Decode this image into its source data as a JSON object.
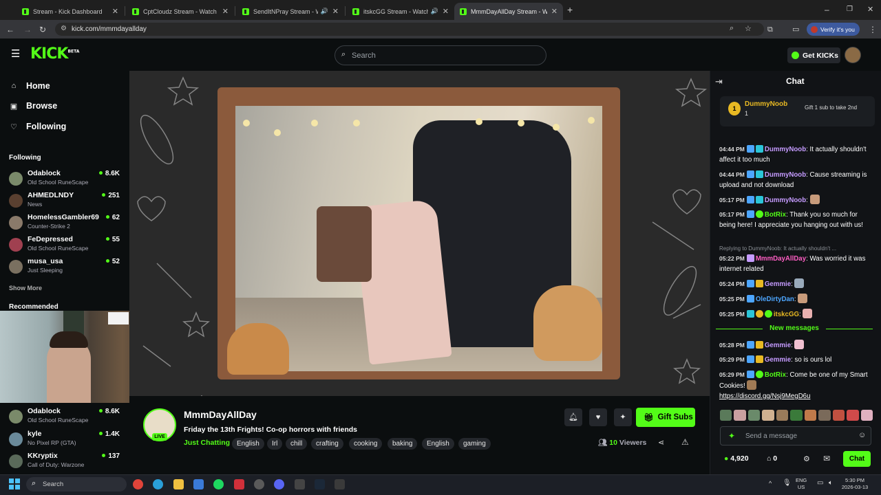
{
  "browser": {
    "tabs": [
      {
        "title": "Stream - Kick Dashboard",
        "active": false,
        "audio": false
      },
      {
        "title": "CptCloudz Stream - Watch Live",
        "active": false,
        "audio": false
      },
      {
        "title": "SendItNPray Stream - Watc",
        "active": false,
        "audio": true
      },
      {
        "title": "itskcGG Stream - Watch Liv",
        "active": false,
        "audio": true
      },
      {
        "title": "MmmDayAllDay Stream - Watc",
        "active": true,
        "audio": false
      }
    ],
    "url": "kick.com/mmmdayallday",
    "verify_label": "Verify it's you"
  },
  "header": {
    "logo": "KICK",
    "logo_sup": "BETA",
    "search_placeholder": "Search",
    "get_kicks_label": "Get KICKs"
  },
  "sidebar": {
    "nav": [
      {
        "label": "Home",
        "icon": "home-icon"
      },
      {
        "label": "Browse",
        "icon": "browse-icon"
      },
      {
        "label": "Following",
        "icon": "heart-icon"
      }
    ],
    "following_heading": "Following",
    "following": [
      {
        "name": "Odablock",
        "game": "Old School RuneScape",
        "viewers": "8.6K",
        "color": "#7a8a6a"
      },
      {
        "name": "AHMEDLNDY",
        "game": "News",
        "viewers": "251",
        "color": "#5a4030"
      },
      {
        "name": "HomelessGambler69",
        "game": "Counter-Strike 2",
        "viewers": "62",
        "color": "#8a7a6a"
      },
      {
        "name": "FeDepressed",
        "game": "Old School RuneScape",
        "viewers": "55",
        "color": "#a04050"
      },
      {
        "name": "musa_usa",
        "game": "Just Sleeping",
        "viewers": "52",
        "color": "#7a7060"
      }
    ],
    "show_more": "Show More",
    "recommended_heading": "Recommended",
    "recommended": [
      {
        "name": "Odablock",
        "game": "Old School RuneScape",
        "viewers": "8.6K",
        "color": "#7a8a6a"
      },
      {
        "name": "kyle",
        "game": "No Pixel RP (GTA)",
        "viewers": "1.4K",
        "color": "#6a8a9a"
      },
      {
        "name": "KKryptix",
        "game": "Call of Duty: Warzone",
        "viewers": "137",
        "color": "#5a6a5a"
      }
    ]
  },
  "stream": {
    "streamer": "MmmDayAllDay",
    "live_badge": "LIVE",
    "title": "Friday the 13th Frights! Co-op horrors with friends",
    "category": "Just Chatting",
    "tags": [
      "English",
      "Irl",
      "chill",
      "crafting",
      "cooking",
      "baking",
      "English",
      "gaming"
    ],
    "gift_subs_label": "Gift Subs",
    "viewers_count": "10",
    "viewers_label": "Viewers"
  },
  "chat": {
    "title": "Chat",
    "pinned": {
      "badge": "1",
      "user": "DummyNoob",
      "sub_count": "1",
      "gift_text": "Gift 1 sub to take 2nd"
    },
    "messages": [
      {
        "time": "04:44 PM",
        "user": "DummyNoob",
        "user_color": "#c59bff",
        "text": "It actually shouldn't affect it too much"
      },
      {
        "time": "04:44 PM",
        "user": "DummyNoob",
        "user_color": "#c59bff",
        "text": "Cause streaming is upload and not download"
      },
      {
        "time": "05:17 PM",
        "user": "DummyNoob",
        "user_color": "#c59bff",
        "text": ""
      },
      {
        "time": "05:17 PM",
        "user": "BotRix",
        "user_color": "#53fc18",
        "text": "Thank you so much for being here! I appreciate you hanging out with us!"
      },
      {
        "time": "05:22 PM",
        "user": "MmmDayAllDay",
        "user_color": "#ff5ec4",
        "text": "Was worried it was internet related"
      },
      {
        "time": "05:24 PM",
        "user": "Gemmie",
        "user_color": "#c59bff",
        "text": ""
      },
      {
        "time": "05:25 PM",
        "user": "OleDirtyDan",
        "user_color": "#4da6ff",
        "text": ""
      },
      {
        "time": "05:25 PM",
        "user": "itskcGG",
        "user_color": "#e8b923",
        "text": ""
      },
      {
        "time": "05:28 PM",
        "user": "Gemmie",
        "user_color": "#c59bff",
        "text": ""
      },
      {
        "time": "05:29 PM",
        "user": "Gemmie",
        "user_color": "#c59bff",
        "text": "so is ours lol"
      },
      {
        "time": "05:29 PM",
        "user": "BotRix",
        "user_color": "#53fc18",
        "text": "Come be one of my Smart Cookies!"
      }
    ],
    "discord_link": "https://discord.gg/Nsj9MegD6u",
    "reply_line": "Replying to DummyNoob: It actually shouldn't ...",
    "new_messages": "New messages",
    "input_placeholder": "Send a message",
    "kicks_balance": "4,920",
    "subs_count": "0",
    "send_label": "Chat"
  },
  "taskbar": {
    "search_placeholder": "Search",
    "lang": "ENG",
    "region": "US",
    "time": "5:30 PM",
    "date": "2026-03-13"
  },
  "colors": {
    "accent": "#53fc18",
    "background": "#0b0e0f",
    "chat_bg": "#111316"
  }
}
